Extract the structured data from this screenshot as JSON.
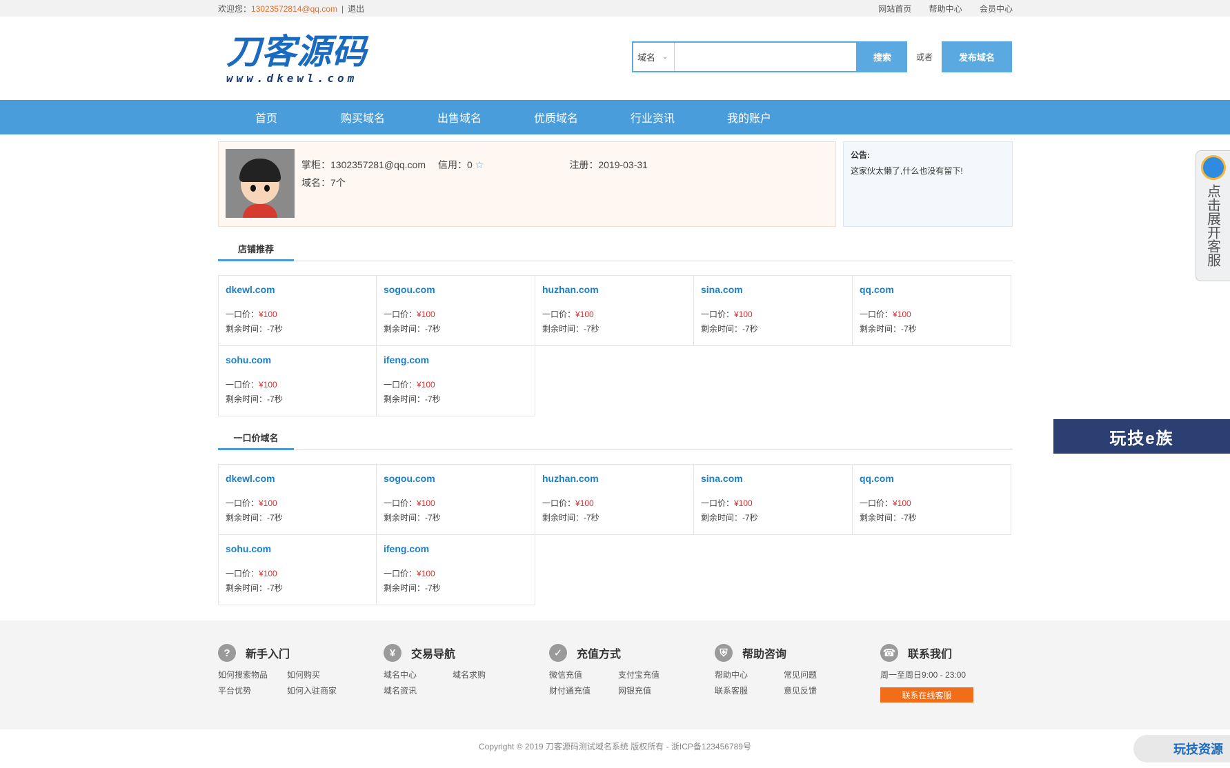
{
  "topbar": {
    "welcome": "欢迎您：",
    "email": "13023572814@qq.com",
    "divider": "|",
    "logout": "退出",
    "links": [
      "网站首页",
      "帮助中心",
      "会员中心"
    ]
  },
  "logo": {
    "cn": "刀客源码",
    "en": "www.dkewl.com"
  },
  "search": {
    "type": "域名",
    "placeholder": "",
    "button": "搜索",
    "or": "或者",
    "publish": "发布域名"
  },
  "nav": [
    "首页",
    "购买域名",
    "出售域名",
    "优质域名",
    "行业资讯",
    "我的账户"
  ],
  "profile": {
    "owner_label": "掌柜：",
    "owner": "1302357281@qq.com",
    "credit_label": "信用：",
    "credit": "0",
    "star": "☆",
    "reg_label": "注册：",
    "reg": "2019-03-31",
    "domains_label": "域名：",
    "domains": "7个"
  },
  "notice": {
    "title": "公告:",
    "text": "这家伙太懒了,什么也没有留下!"
  },
  "sections": [
    {
      "title": "店铺推荐"
    },
    {
      "title": "一口价域名"
    }
  ],
  "labels": {
    "price": "一口价：",
    "remain": "剩余时间："
  },
  "domains": [
    {
      "name": "dkewl.com",
      "price": "¥100",
      "remain": "-7秒"
    },
    {
      "name": "sogou.com",
      "price": "¥100",
      "remain": "-7秒"
    },
    {
      "name": "huzhan.com",
      "price": "¥100",
      "remain": "-7秒"
    },
    {
      "name": "sina.com",
      "price": "¥100",
      "remain": "-7秒"
    },
    {
      "name": "qq.com",
      "price": "¥100",
      "remain": "-7秒"
    },
    {
      "name": "sohu.com",
      "price": "¥100",
      "remain": "-7秒"
    },
    {
      "name": "ifeng.com",
      "price": "¥100",
      "remain": "-7秒"
    }
  ],
  "footer": {
    "cols": [
      {
        "title": "新手入门",
        "icon": "question-icon",
        "links": [
          "如何搜索物品",
          "如何购买",
          "平台优势",
          "如何入驻商家"
        ]
      },
      {
        "title": "交易导航",
        "icon": "user-yen-icon",
        "links": [
          "域名中心",
          "域名求购",
          "域名资讯"
        ]
      },
      {
        "title": "充值方式",
        "icon": "user-check-icon",
        "links": [
          "微信充值",
          "支付宝充值",
          "财付通充值",
          "网银充值"
        ]
      },
      {
        "title": "帮助咨询",
        "icon": "shield-icon",
        "links": [
          "帮助中心",
          "常见问题",
          "联系客服",
          "意见反馈"
        ]
      },
      {
        "title": "联系我们",
        "icon": "phone-icon",
        "hours": "周一至周日9:00 - 23:00",
        "button": "联系在线客服"
      }
    ],
    "copyright": "Copyright © 2019 刀客源码测试域名系统 版权所有 - 浙ICP备123456789号"
  },
  "side": {
    "cs_text": "点击展开客服",
    "ad": "玩技e族",
    "corner": "玩技资源"
  }
}
